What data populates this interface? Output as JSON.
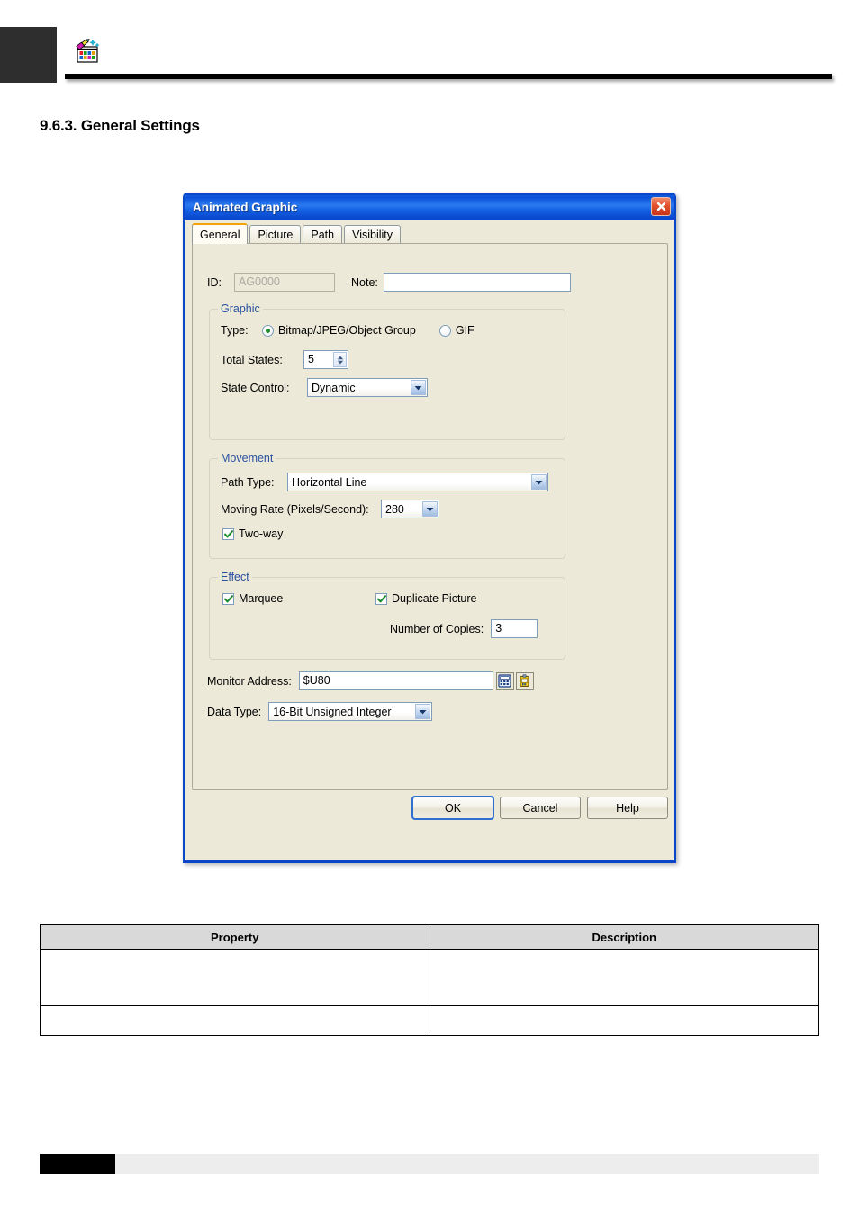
{
  "page": {
    "header_icon": "animated-graphic-icon",
    "section_title": "9.6.3. General Settings"
  },
  "dialog": {
    "title": "Animated Graphic",
    "close_icon": "close-icon",
    "tabs": [
      {
        "label": "General",
        "active": true
      },
      {
        "label": "Picture",
        "active": false
      },
      {
        "label": "Path",
        "active": false
      },
      {
        "label": "Visibility",
        "active": false
      }
    ],
    "id_label": "ID:",
    "id_value": "AG0000",
    "note_label": "Note:",
    "note_value": "",
    "graphic": {
      "group_label": "Graphic",
      "type_label": "Type:",
      "type_option_1": "Bitmap/JPEG/Object Group",
      "type_option_2": "GIF",
      "type_selected": "Bitmap/JPEG/Object Group",
      "total_states_label": "Total States:",
      "total_states_value": "5",
      "state_control_label": "State Control:",
      "state_control_value": "Dynamic"
    },
    "movement": {
      "group_label": "Movement",
      "path_type_label": "Path Type:",
      "path_type_value": "Horizontal Line",
      "moving_rate_label": "Moving Rate (Pixels/Second):",
      "moving_rate_value": "280",
      "two_way_label": "Two-way",
      "two_way_checked": true
    },
    "effect": {
      "group_label": "Effect",
      "marquee_label": "Marquee",
      "marquee_checked": true,
      "duplicate_label": "Duplicate Picture",
      "duplicate_checked": true,
      "copies_label": "Number of Copies:",
      "copies_value": "3"
    },
    "monitor_address_label": "Monitor Address:",
    "monitor_address_value": "$U80",
    "keypad_icon": "keypad-icon",
    "tag_icon": "tag-icon",
    "data_type_label": "Data Type:",
    "data_type_value": "16-Bit Unsigned Integer",
    "buttons": {
      "ok": "OK",
      "cancel": "Cancel",
      "help": "Help"
    }
  },
  "table": {
    "headers": [
      "Property",
      "Description"
    ],
    "rows": [
      {
        "property": "",
        "description": ""
      },
      {
        "property": "",
        "description": ""
      }
    ]
  },
  "colors": {
    "titlebar_blue": "#0a46c8",
    "tab_accent_orange": "#f3a208",
    "group_label_blue": "#2850a0",
    "dialog_face": "#ece9d8",
    "check_green": "#1b8a2a"
  }
}
